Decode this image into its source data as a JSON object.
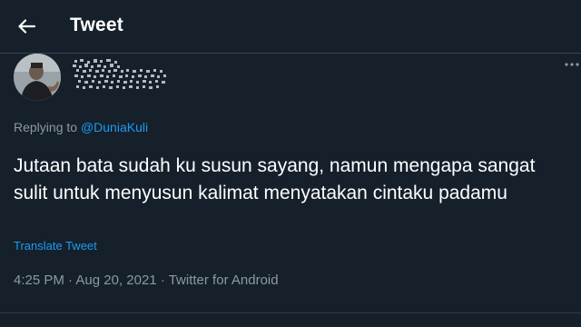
{
  "header": {
    "title": "Tweet",
    "back_icon": "arrow-left-icon"
  },
  "author": {
    "avatar_icon": "profile-photo",
    "more_icon": "ellipsis-icon"
  },
  "reply": {
    "prefix": "Replying to",
    "handle": "@DuniaKuli"
  },
  "tweet": {
    "text": "Jutaan bata sudah ku susun sayang, namun mengapa sangat sulit untuk menyusun kalimat menyatakan cintaku padamu",
    "translate_label": "Translate Tweet",
    "time": "4:25 PM",
    "date": "Aug 20, 2021",
    "client": "Twitter for Android",
    "separator": "·"
  },
  "colors": {
    "background": "#15202b",
    "accent": "#1d9bf0",
    "muted": "#8b98a5",
    "text": "#ffffff"
  }
}
